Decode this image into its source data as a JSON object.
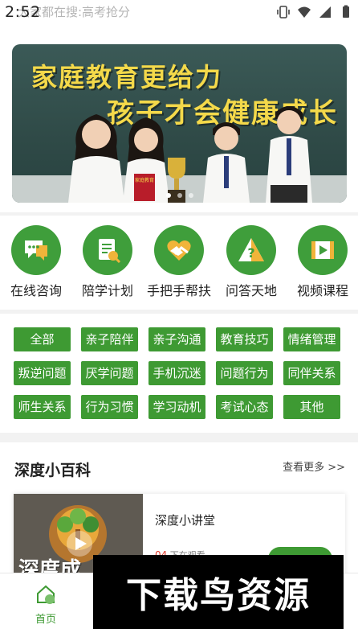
{
  "status_bar": {
    "time": "2:52"
  },
  "search": {
    "placeholder": "大家都在搜:高考抢分"
  },
  "banner": {
    "headline1": "家庭教育更给力",
    "headline2": "孩子才会健康成长",
    "book_text": "家庭教育",
    "dots": 3,
    "active_dot": 0
  },
  "menu": {
    "items": [
      {
        "label": "在线咨询",
        "icon": "chat-bubbles-icon"
      },
      {
        "label": "陪学计划",
        "icon": "plan-document-icon"
      },
      {
        "label": "手把手帮扶",
        "icon": "handshake-heart-icon"
      },
      {
        "label": "问答天地",
        "icon": "question-triangle-icon"
      },
      {
        "label": "视频课程",
        "icon": "video-film-icon"
      }
    ]
  },
  "tags": {
    "rows": [
      [
        "全部",
        "亲子陪伴",
        "亲子沟通",
        "教育技巧",
        "情绪管理"
      ],
      [
        "叛逆问题",
        "厌学问题",
        "手机沉迷",
        "问题行为",
        "同伴关系"
      ],
      [
        "师生关系",
        "行为习惯",
        "学习动机",
        "考试心态",
        "其他"
      ]
    ]
  },
  "section": {
    "title": "深度小百科",
    "more": "查看更多 >>",
    "card": {
      "title": "深度小讲堂",
      "views_count": "04",
      "views_suffix": "下在观看",
      "thumb_logo_text": "深度成"
    }
  },
  "tabbar": {
    "home_label": "首页",
    "home_icon": "home-icon"
  },
  "watermark": {
    "text": "下载鸟资源"
  },
  "colors": {
    "accent_green": "#3e9a33",
    "banner_text": "#f4d94a",
    "hot_red": "#e03a2a"
  }
}
